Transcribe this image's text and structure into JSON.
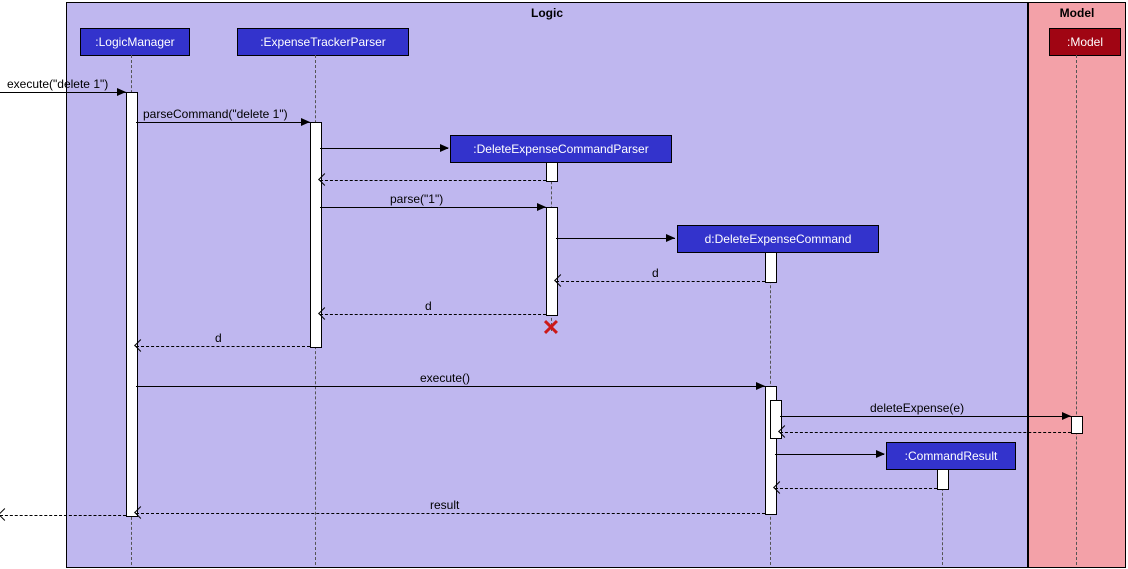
{
  "frames": {
    "logic": {
      "title": "Logic"
    },
    "model": {
      "title": "Model"
    }
  },
  "lifelines": {
    "logicManager": {
      "label": ":LogicManager"
    },
    "expenseTrackerParser": {
      "label": ":ExpenseTrackerParser"
    },
    "deleteExpenseCommandParser": {
      "label": ":DeleteExpenseCommandParser"
    },
    "deleteExpenseCommand": {
      "label": "d:DeleteExpenseCommand"
    },
    "commandResult": {
      "label": ":CommandResult"
    },
    "model": {
      "label": ":Model"
    }
  },
  "messages": {
    "executeEntry": "execute(\"delete 1\")",
    "parseCommand": "parseCommand(\"delete 1\")",
    "parse": "parse(\"1\")",
    "returnD1": "d",
    "returnD2": "d",
    "returnD3": "d",
    "executeCall": "execute()",
    "deleteExpense": "deleteExpense(e)",
    "resultReturn": "result"
  }
}
